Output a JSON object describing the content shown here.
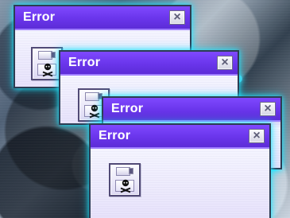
{
  "windows": [
    {
      "title": "Error",
      "close_label": "×",
      "icon": "floppy-disk-skull-icon"
    },
    {
      "title": "Error",
      "close_label": "×",
      "icon": "floppy-disk-skull-icon"
    },
    {
      "title": "Error",
      "close_label": "×",
      "icon": "floppy-disk-skull-icon"
    },
    {
      "title": "Error",
      "close_label": "×",
      "icon": "floppy-disk-skull-icon"
    }
  ],
  "colors": {
    "titlebar": "#6a35eb",
    "titlebar_highlight": "#7f49ff",
    "window_background": "#eef1ff",
    "glow": "#2ae2ff",
    "close_button": "#d6d6e4"
  }
}
